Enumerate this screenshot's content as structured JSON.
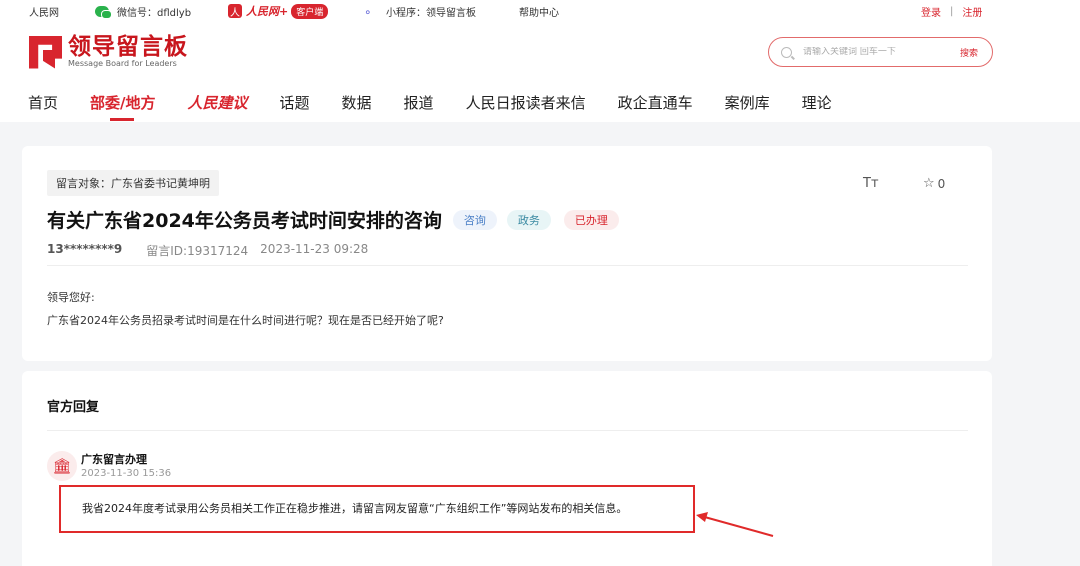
{
  "topbar": {
    "site": "人民网",
    "wechat": "微信号：dfldlyb",
    "rmw_glyph": "人",
    "rmw_name": "人民网+",
    "rmw_client": "客户端",
    "miniprogram": "小程序：领导留言板",
    "help": "帮助中心",
    "login": "登录",
    "separator": "|",
    "register": "注册"
  },
  "header": {
    "logo_title": "领导留言板",
    "logo_subtitle": "Message Board for Leaders",
    "search_placeholder": "请输入关键词 回车一下",
    "search_button": "搜索"
  },
  "nav": {
    "items": [
      {
        "label": "首页"
      },
      {
        "label": "部委/地方"
      },
      {
        "label": "人民建议"
      },
      {
        "label": "话题"
      },
      {
        "label": "数据"
      },
      {
        "label": "报道"
      },
      {
        "label": "人民日报读者来信"
      },
      {
        "label": "政企直通车"
      },
      {
        "label": "案例库"
      },
      {
        "label": "理论"
      }
    ]
  },
  "message": {
    "target": "留言对象：广东省委书记黄坤明",
    "font_toggle": "Tт",
    "star_glyph": "☆",
    "star_count": "0",
    "title": "有关广东省2024年公务员考试时间安排的咨询",
    "tags": [
      "咨询",
      "政务",
      "已办理"
    ],
    "author": "13********9",
    "message_id": "留言ID:19317124",
    "datetime": "2023-11-23 09:28",
    "greeting": "领导您好:",
    "content": "广东省2024年公务员招录考试时间是在什么时间进行呢？现在是否已经开始了呢?"
  },
  "reply": {
    "heading": "官方回复",
    "org_icon": "🏛",
    "org_name": "广东留言办理",
    "org_time": "2023-11-30 15:36",
    "content": "我省2024年度考试录用公务员相关工作正在稳步推进，请留言网友留意“广东组织工作”等网站发布的相关信息。"
  },
  "colors": {
    "brand_red": "#d8252e",
    "annotation_red": "#e02a2a"
  }
}
